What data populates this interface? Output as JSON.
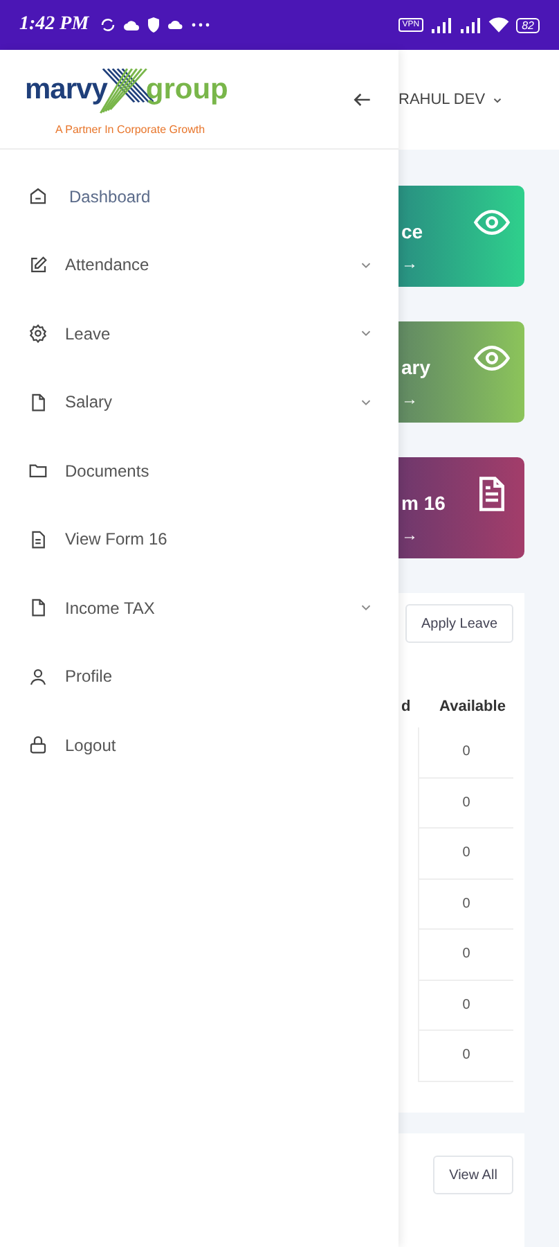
{
  "status_bar": {
    "time": "1:42 PM",
    "vpn": "VPN",
    "battery": "82"
  },
  "drawer": {
    "brand": {
      "name_left": "marvy",
      "name_right": "group",
      "tagline": "A Partner In Corporate Growth"
    },
    "items": [
      {
        "label": "Dashboard",
        "kind": "home",
        "expandable": false,
        "selected": true
      },
      {
        "label": "Attendance",
        "kind": "edit",
        "expandable": true,
        "selected": false
      },
      {
        "label": "Leave",
        "kind": "gear",
        "expandable": true,
        "selected": false
      },
      {
        "label": "Salary",
        "kind": "file",
        "expandable": true,
        "selected": false
      },
      {
        "label": "Documents",
        "kind": "folder",
        "expandable": false,
        "selected": false
      },
      {
        "label": "View Form 16",
        "kind": "filetext",
        "expandable": false,
        "selected": false
      },
      {
        "label": "Income TAX",
        "kind": "file",
        "expandable": true,
        "selected": false
      },
      {
        "label": "Profile",
        "kind": "user",
        "expandable": false,
        "selected": false
      },
      {
        "label": "Logout",
        "kind": "lock",
        "expandable": false,
        "selected": false
      }
    ]
  },
  "main": {
    "user": "RAHUL DEV",
    "cards": [
      {
        "title": "ce",
        "arrow": "→",
        "kind": "eye",
        "color": "#2fd08c"
      },
      {
        "title": "ary",
        "arrow": "→",
        "kind": "eye",
        "color": "#8cc45a"
      },
      {
        "title": "m 16",
        "arrow": "→",
        "kind": "doc",
        "color": "#a33d6a"
      }
    ],
    "leave": {
      "button": "Apply Leave",
      "columns": [
        "d",
        "Available"
      ],
      "rows": [
        {
          "available": "0"
        },
        {
          "available": "0"
        },
        {
          "available": "0"
        },
        {
          "available": "0"
        },
        {
          "available": "0"
        },
        {
          "available": "0"
        },
        {
          "available": "0"
        }
      ]
    },
    "recent": {
      "button": "View All"
    }
  }
}
